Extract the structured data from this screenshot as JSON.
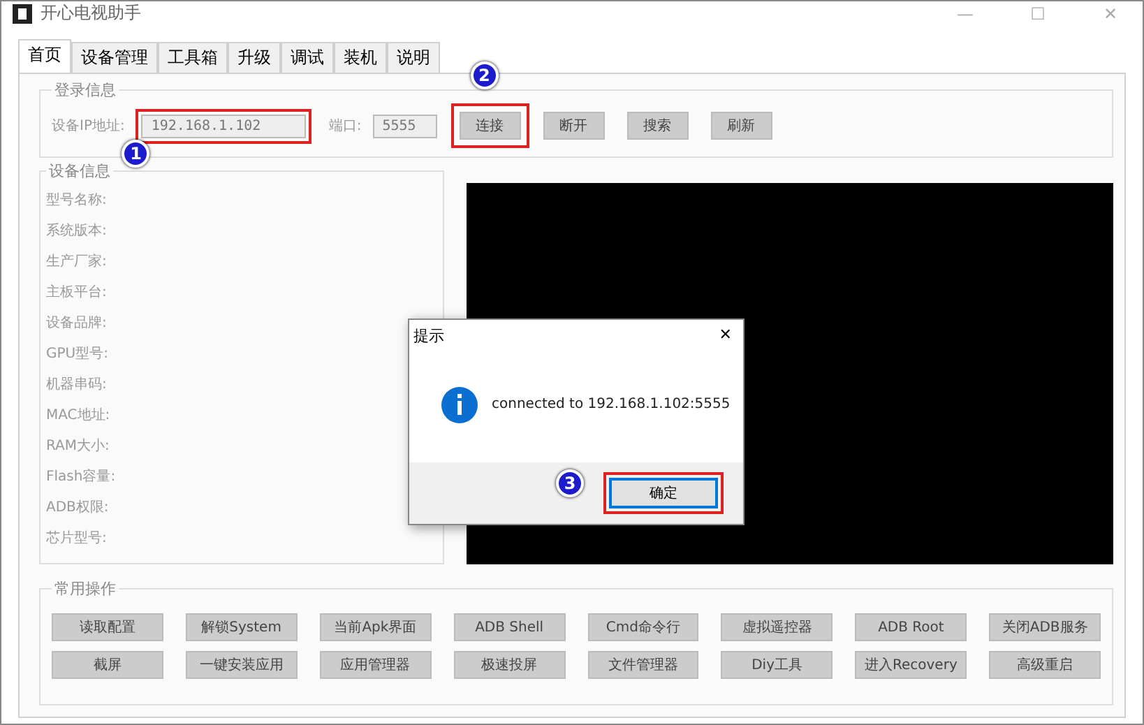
{
  "window": {
    "title": "开心电视助手",
    "controls": [
      "—",
      "☐",
      "✕"
    ]
  },
  "tabs": [
    {
      "label": "首页",
      "selected": true
    },
    {
      "label": "设备管理",
      "selected": false
    },
    {
      "label": "工具箱",
      "selected": false
    },
    {
      "label": "升级",
      "selected": false
    },
    {
      "label": "调试",
      "selected": false
    },
    {
      "label": "装机",
      "selected": false
    },
    {
      "label": "说明",
      "selected": false
    }
  ],
  "login": {
    "title": "登录信息",
    "ip_label": "设备IP地址:",
    "ip_value": "192.168.1.102",
    "ip_highlighted": true,
    "ip_annotation": "1",
    "port_label": "端口:",
    "port_value": "5555",
    "buttons": [
      {
        "label": "连接",
        "highlighted": true,
        "annotation": "2"
      },
      {
        "label": "断开",
        "highlighted": false
      },
      {
        "label": "搜索",
        "highlighted": false
      },
      {
        "label": "刷新",
        "highlighted": false
      }
    ]
  },
  "device_info": {
    "title": "设备信息",
    "fields": [
      "型号名称:",
      "系统版本:",
      "生产厂家:",
      "主板平台:",
      "设备品牌:",
      "GPU型号:",
      "机器串码:",
      "MAC地址:",
      "RAM大小:",
      "Flash容量:",
      "ADB权限:",
      "芯片型号:"
    ]
  },
  "common": {
    "title": "常用操作",
    "buttons": [
      "读取配置",
      "解锁System",
      "当前Apk界面",
      "ADB Shell",
      "Cmd命令行",
      "虚拟遥控器",
      "ADB  Root",
      "关闭ADB服务",
      "截屏",
      "一键安装应用",
      "应用管理器",
      "极速投屏",
      "文件管理器",
      "Diy工具",
      "进入Recovery",
      "高级重启"
    ]
  },
  "dialog": {
    "title": "提示",
    "close": "✕",
    "message": "connected to 192.168.1.102:5555",
    "ok": "确定",
    "ok_highlighted": true,
    "ok_annotation": "3"
  }
}
